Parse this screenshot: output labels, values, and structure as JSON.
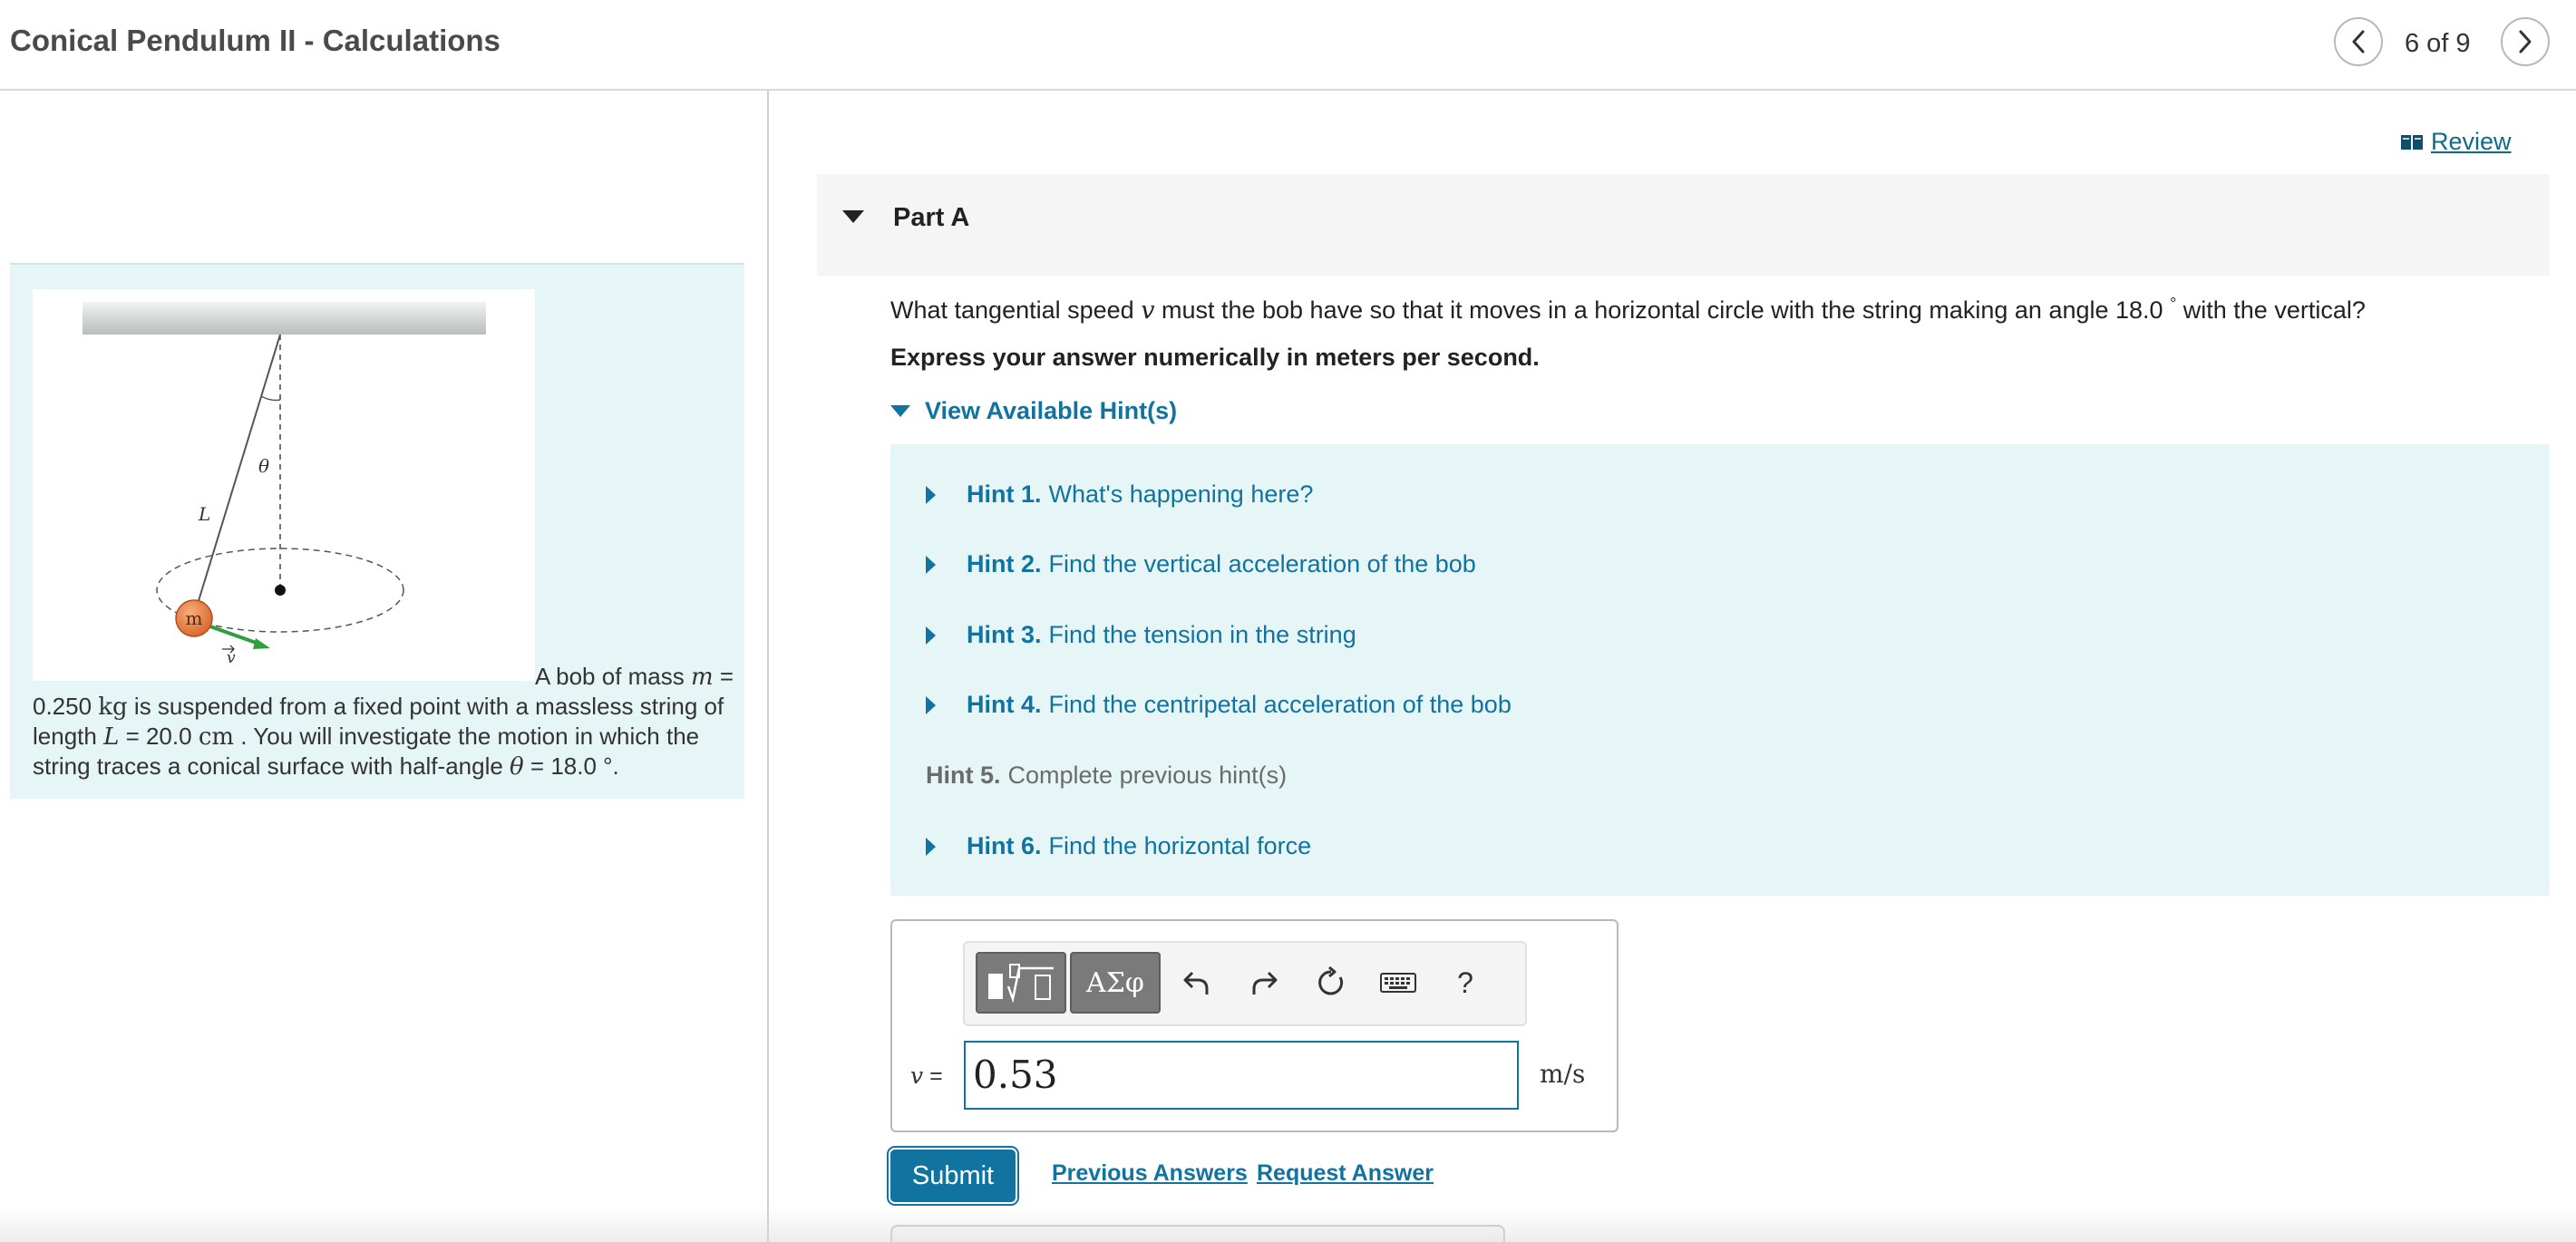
{
  "header": {
    "title": "Conical Pendulum II - Calculations",
    "pager": "6 of 9",
    "prev_icon": "chevron-left-icon",
    "next_icon": "chevron-right-icon"
  },
  "intro": {
    "figure_labels": {
      "length": "L",
      "angle": "θ",
      "mass": "m",
      "velocity": "v"
    },
    "text_1": "A bob of mass ",
    "var_m": "m",
    "text_2": " = 0.250 ",
    "unit_kg": "kg",
    "text_3": " is suspended from a fixed point with a massless string of length ",
    "var_L": "L",
    "text_4": " = 20.0 ",
    "unit_cm": "cm",
    "text_5": " . You will investigate the motion in which the string traces a conical surface with half-angle ",
    "var_theta": "θ",
    "text_6": " = 18.0 °."
  },
  "review": {
    "label": "Review",
    "icon": "book-icon"
  },
  "part": {
    "title": "Part A"
  },
  "question": {
    "text_1": "What tangential speed ",
    "var_v": "v",
    "text_2": " must the bob have so that it moves in a horizontal circle with the string making an angle 18.0 ",
    "degree": "°",
    "text_3": " with the vertical?",
    "instruction": "Express your answer numerically in meters per second."
  },
  "hints": {
    "toggle_label": "View Available Hint(s)",
    "items": [
      {
        "num": "Hint 1.",
        "text": "What's happening here?"
      },
      {
        "num": "Hint 2.",
        "text": "Find the vertical acceleration of the bob"
      },
      {
        "num": "Hint 3.",
        "text": "Find the tension in the string"
      },
      {
        "num": "Hint 4.",
        "text": "Find the centripetal acceleration of the bob"
      },
      {
        "num": "Hint 5.",
        "text": "Complete previous hint(s)"
      },
      {
        "num": "Hint 6.",
        "text": "Find the horizontal force"
      }
    ]
  },
  "answer": {
    "variable": "v",
    "equals": "=",
    "value": "0.53",
    "unit": "m/s",
    "toolbar": {
      "templates_icon": "math-templates-icon",
      "symbols_label": "ΑΣφ",
      "undo_icon": "undo-icon",
      "redo_icon": "redo-icon",
      "reset_icon": "reset-icon",
      "keyboard_icon": "keyboard-icon",
      "help_label": "?"
    }
  },
  "actions": {
    "submit": "Submit",
    "previous_answers": "Previous Answers",
    "request_answer": "Request Answer"
  },
  "colors": {
    "accent": "#1173a0",
    "hint_bg": "#e6f5f5",
    "bob": "#e07a3a",
    "velocity_arrow": "#2e9e3e"
  }
}
